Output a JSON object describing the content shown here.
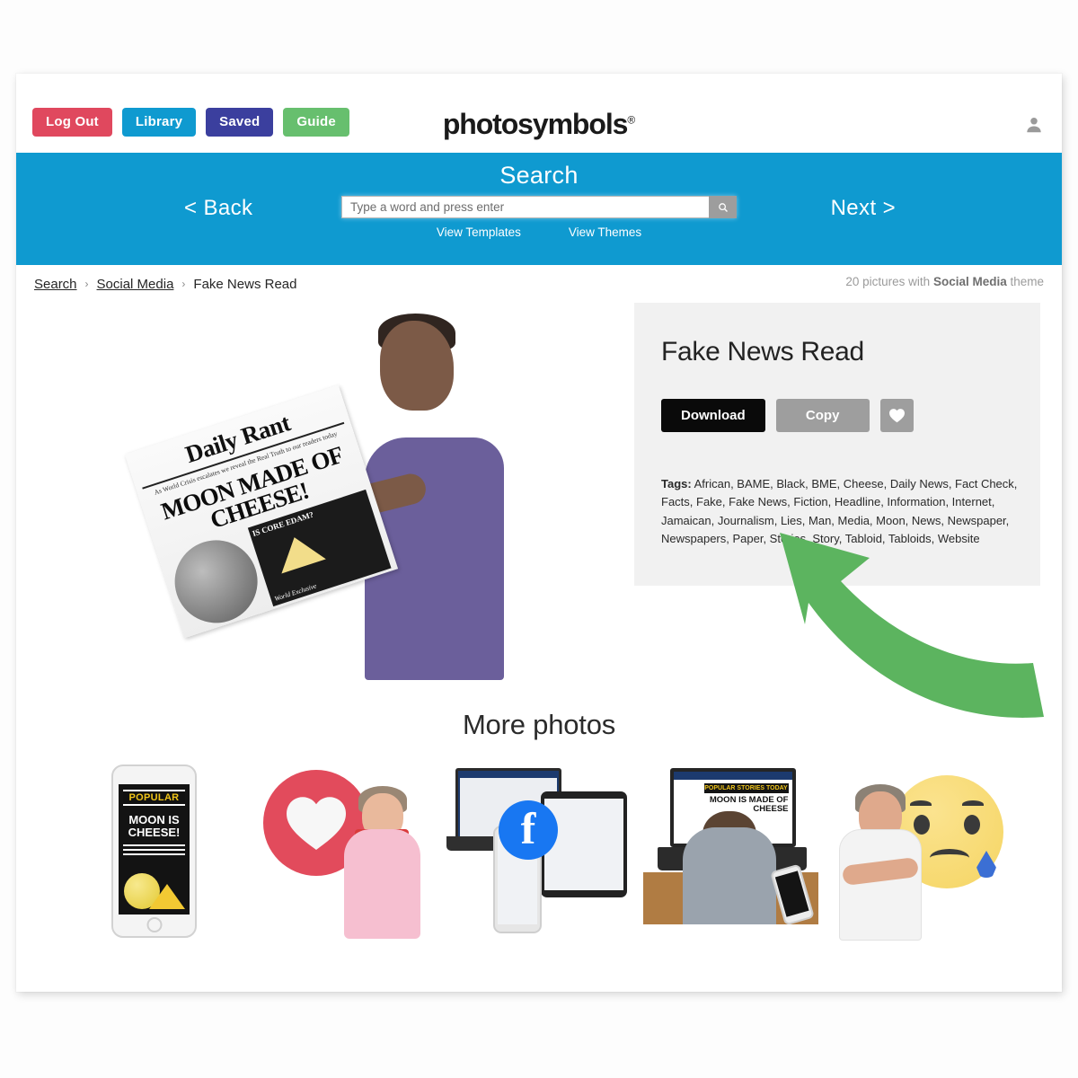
{
  "topbar": {
    "buttons": [
      {
        "label": "Log Out",
        "name": "logout-button",
        "color": "#e0485e"
      },
      {
        "label": "Library",
        "name": "library-button",
        "color": "#0f9ad0"
      },
      {
        "label": "Saved",
        "name": "saved-button",
        "color": "#3b3f9e"
      },
      {
        "label": "Guide",
        "name": "guide-button",
        "color": "#67bf6e"
      }
    ],
    "brand": "photosymbols",
    "brand_mark": "®",
    "account_icon": "user-icon"
  },
  "search": {
    "title": "Search",
    "placeholder": "Type a word and press enter",
    "value": "",
    "submit_icon": "search-icon",
    "back_label": "< Back",
    "next_label": "Next >",
    "sublinks": [
      "View Templates",
      "View Themes"
    ],
    "band_color": "#0f9ad0"
  },
  "breadcrumb": {
    "items": [
      "Search",
      "Social Media",
      "Fake News Read"
    ],
    "separator": "›"
  },
  "theme_count": {
    "prefix": "20 pictures with ",
    "theme": "Social Media",
    "suffix": " theme"
  },
  "detail": {
    "title": "Fake News Read",
    "download_label": "Download",
    "copy_label": "Copy",
    "favourite_icon": "heart-icon",
    "tags_label": "Tags:",
    "tags": [
      "African",
      "BAME",
      "Black",
      "BME",
      "Cheese",
      "Daily News",
      "Fact Check",
      "Facts",
      "Fake",
      "Fake News",
      "Fiction",
      "Headline",
      "Information",
      "Internet",
      "Jamaican",
      "Journalism",
      "Lies",
      "Man",
      "Media",
      "Moon",
      "News",
      "Newspaper",
      "Newspapers",
      "Paper",
      "Stories",
      "Story",
      "Tabloid",
      "Tabloids",
      "Website"
    ]
  },
  "hero": {
    "newspaper_masthead": "Daily Rant",
    "newspaper_kicker": "As World Crisis escalates we reveal the Real Truth to our readers today",
    "newspaper_headline": "MOON MADE OF CHEESE!",
    "newspaper_box_title": "IS CORE EDAM?",
    "newspaper_box_caption": "World Exclusive"
  },
  "more": {
    "heading": "More photos",
    "thumbs": [
      {
        "name": "thumb-phone-popular-moon",
        "phone_label": "POPULAR",
        "phone_headline": "MOON IS CHEESE!"
      },
      {
        "name": "thumb-heart-woman"
      },
      {
        "name": "thumb-social-devices",
        "logo": "f"
      },
      {
        "name": "thumb-laptop-man",
        "banner": "POPULAR STORIES TODAY",
        "headline": "MOON IS MADE OF CHEESE"
      },
      {
        "name": "thumb-sad-emoji-woman"
      }
    ]
  },
  "annotation": {
    "arrow_color": "#5cb45f",
    "arrow_direction": "up-left"
  }
}
